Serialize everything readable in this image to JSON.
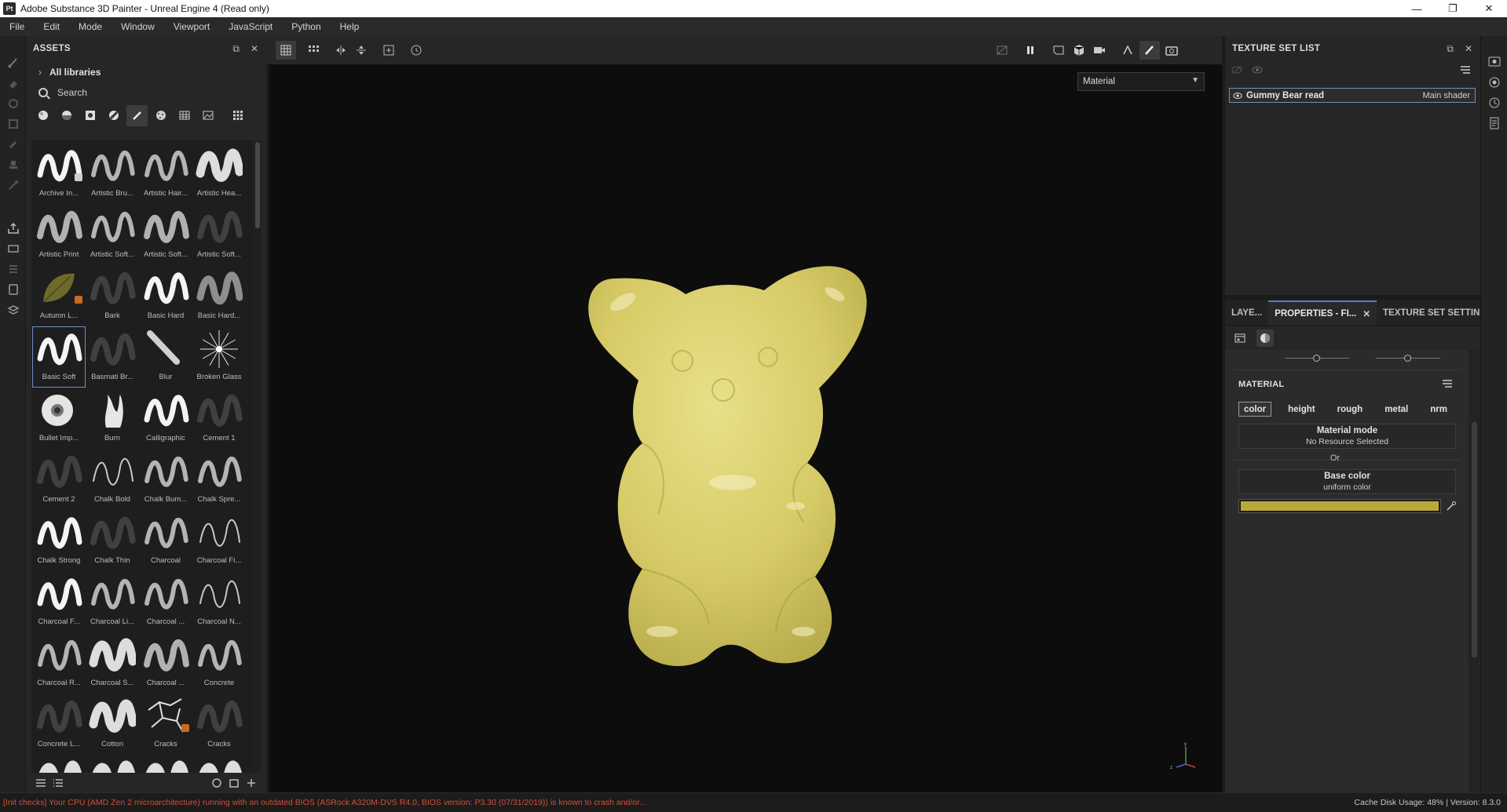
{
  "window": {
    "app_icon_text": "Pt",
    "title": "Adobe Substance 3D Painter - Unreal Engine 4 (Read only)",
    "controls": [
      "—",
      "❐",
      "✕"
    ]
  },
  "menu": [
    "File",
    "Edit",
    "Mode",
    "Window",
    "Viewport",
    "JavaScript",
    "Python",
    "Help"
  ],
  "assets": {
    "title": "ASSETS",
    "library": "All libraries",
    "search_placeholder": "Search",
    "tiles": [
      {
        "label": "Archive In...",
        "stroke": "solid",
        "badge": "ps"
      },
      {
        "label": "Artistic Bru...",
        "stroke": "bristle"
      },
      {
        "label": "Artistic Hair...",
        "stroke": "bristle"
      },
      {
        "label": "Artistic Hea...",
        "stroke": "heavy"
      },
      {
        "label": "Artistic Print",
        "stroke": "dotted"
      },
      {
        "label": "Artistic Soft...",
        "stroke": "bristle"
      },
      {
        "label": "Artistic Soft...",
        "stroke": "dotted"
      },
      {
        "label": "Artistic Soft...",
        "stroke": "faint"
      },
      {
        "label": "Autumn L...",
        "stroke": "leaf",
        "badge": "orange"
      },
      {
        "label": "Bark",
        "stroke": "faint"
      },
      {
        "label": "Basic Hard",
        "stroke": "solid"
      },
      {
        "label": "Basic Hard...",
        "stroke": "grey"
      },
      {
        "label": "Basic Soft",
        "stroke": "solid",
        "selected": true
      },
      {
        "label": "Basmati Br...",
        "stroke": "faint"
      },
      {
        "label": "Blur",
        "stroke": "blur"
      },
      {
        "label": "Broken Glass",
        "stroke": "glass"
      },
      {
        "label": "Bullet Imp...",
        "stroke": "bullet"
      },
      {
        "label": "Burn",
        "stroke": "burn"
      },
      {
        "label": "Calligraphic",
        "stroke": "solid"
      },
      {
        "label": "Cement 1",
        "stroke": "faint"
      },
      {
        "label": "Cement 2",
        "stroke": "faint"
      },
      {
        "label": "Chalk Bold",
        "stroke": "thin"
      },
      {
        "label": "Chalk Bum...",
        "stroke": "bristle"
      },
      {
        "label": "Chalk Spre...",
        "stroke": "bristle"
      },
      {
        "label": "Chalk Strong",
        "stroke": "solid"
      },
      {
        "label": "Chalk Thin",
        "stroke": "faint"
      },
      {
        "label": "Charcoal",
        "stroke": "bristle"
      },
      {
        "label": "Charcoal Fi...",
        "stroke": "thin"
      },
      {
        "label": "Charcoal F...",
        "stroke": "solid"
      },
      {
        "label": "Charcoal Li...",
        "stroke": "bristle"
      },
      {
        "label": "Charcoal ...",
        "stroke": "bristle"
      },
      {
        "label": "Charcoal N...",
        "stroke": "thin"
      },
      {
        "label": "Charcoal R...",
        "stroke": "bristle"
      },
      {
        "label": "Charcoal S...",
        "stroke": "heavy"
      },
      {
        "label": "Charcoal ...",
        "stroke": "dotted"
      },
      {
        "label": "Concrete",
        "stroke": "bristle"
      },
      {
        "label": "Concrete L...",
        "stroke": "faint"
      },
      {
        "label": "Cotton",
        "stroke": "heavy"
      },
      {
        "label": "Cracks",
        "stroke": "cracks",
        "badge": "orange"
      },
      {
        "label": "Cracks",
        "stroke": "faint"
      },
      {
        "label": "",
        "stroke": "heavy"
      },
      {
        "label": "",
        "stroke": "heavy"
      },
      {
        "label": "",
        "stroke": "heavy"
      },
      {
        "label": "",
        "stroke": "heavy"
      }
    ]
  },
  "viewport": {
    "mode_select": "Material",
    "axis": {
      "y": "y",
      "z": "z"
    }
  },
  "texture_set_list": {
    "title": "TEXTURE SET LIST",
    "row": {
      "name": "Gummy Bear read",
      "shader": "Main shader"
    }
  },
  "properties": {
    "tabs": [
      "LAYE...",
      "PROPERTIES - FI...",
      "TEXTURE SET SETTIN..."
    ],
    "material_title": "MATERIAL",
    "channels": [
      "color",
      "height",
      "rough",
      "metal",
      "nrm"
    ],
    "material_mode": {
      "title": "Material mode",
      "value": "No Resource Selected"
    },
    "or_text": "Or",
    "base_color": {
      "title": "Base color",
      "value": "uniform color",
      "swatch": "#b9a93a"
    }
  },
  "status": {
    "error": "[Init checks] Your CPU (AMD Zen 2 microarchitecture) running with an outdated BIOS (ASRock A320M-DVS R4.0, BIOS version: P3.30 (07/31/2019)) is known to crash and/or...",
    "right": "Cache Disk Usage:   48% | Version: 8.3.0"
  },
  "colors": {
    "accent": "#4f7fd3",
    "gummy": "#d9cf6a",
    "error": "#d0503c"
  }
}
